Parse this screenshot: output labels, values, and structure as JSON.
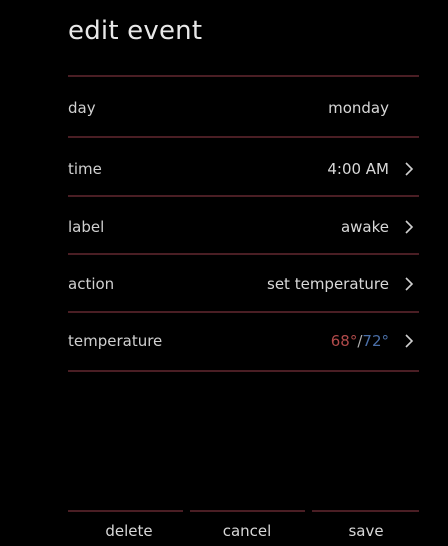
{
  "screen": {
    "title": "edit event"
  },
  "rows": [
    {
      "label": "day",
      "value": "monday",
      "has_chevron": false
    },
    {
      "label": "time",
      "value": "4:00 AM",
      "has_chevron": true
    },
    {
      "label": "label",
      "value": "awake",
      "has_chevron": true
    },
    {
      "label": "action",
      "value": "set temperature",
      "has_chevron": true
    },
    {
      "label": "temperature",
      "heat": "68°",
      "separator": "/",
      "cool": "72°",
      "has_chevron": true
    }
  ],
  "buttons": {
    "delete": "delete",
    "cancel": "cancel",
    "save": "save"
  },
  "colors": {
    "background": "#000000",
    "divider": "#4a1e24",
    "heat": "#b04a4a",
    "cool": "#4a6fa8"
  },
  "icons": {
    "chevron": "chevron-right-icon"
  }
}
